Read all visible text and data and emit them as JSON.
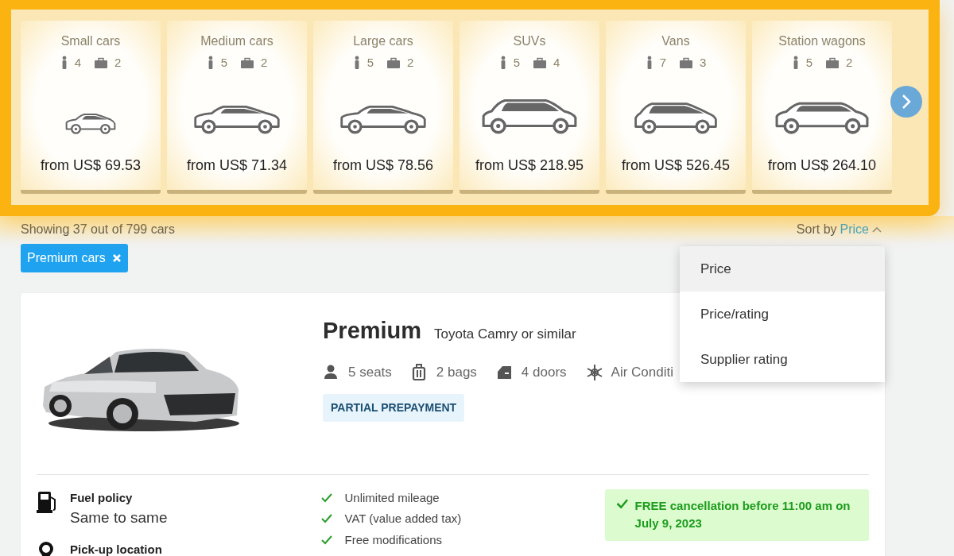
{
  "car_classes": [
    {
      "name": "Small cars",
      "seats": "4",
      "bags": "2",
      "price": "from US$ 69.53",
      "kind": "hatchback"
    },
    {
      "name": "Medium cars",
      "seats": "5",
      "bags": "2",
      "price": "from US$ 71.34",
      "kind": "sedan"
    },
    {
      "name": "Large cars",
      "seats": "5",
      "bags": "2",
      "price": "from US$ 78.56",
      "kind": "sedan"
    },
    {
      "name": "SUVs",
      "seats": "5",
      "bags": "4",
      "price": "from US$ 218.95",
      "kind": "suv"
    },
    {
      "name": "Vans",
      "seats": "7",
      "bags": "3",
      "price": "from US$ 526.45",
      "kind": "van"
    },
    {
      "name": "Station wagons",
      "seats": "5",
      "bags": "2",
      "price": "from US$ 264.10",
      "kind": "wagon"
    }
  ],
  "results": {
    "summary": "Showing 37 out of 799 cars",
    "sort_label": "Sort by",
    "sort_value": "Price"
  },
  "filters": [
    {
      "label": "Premium cars"
    }
  ],
  "sort_menu": [
    {
      "label": "Price",
      "selected": true
    },
    {
      "label": "Price/rating",
      "selected": false
    },
    {
      "label": "Supplier rating",
      "selected": false
    }
  ],
  "offer": {
    "category": "Premium",
    "model": "Toyota Camry or similar",
    "features": [
      {
        "kind": "seats",
        "text": "5 seats"
      },
      {
        "kind": "bags",
        "text": "2 bags"
      },
      {
        "kind": "doors",
        "text": "4 doors"
      },
      {
        "kind": "ac",
        "text": "Air Conditi"
      }
    ],
    "badge": "PARTIAL PREPAYMENT",
    "details": [
      {
        "kind": "fuel",
        "label": "Fuel policy",
        "value": "Same to same"
      },
      {
        "kind": "location",
        "label": "Pick-up location"
      }
    ],
    "inclusions": [
      "Unlimited mileage",
      "VAT (value added tax)",
      "Free modifications"
    ],
    "cancellation": "FREE cancellation before 11:00 am on July 9, 2023"
  }
}
